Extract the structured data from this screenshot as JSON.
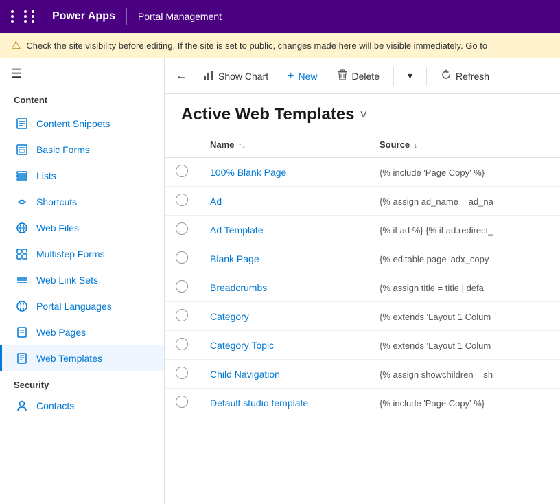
{
  "topbar": {
    "grid_label": "apps-grid",
    "title": "Power Apps",
    "subtitle": "Portal Management"
  },
  "warning": {
    "icon": "⚠",
    "text": "Check the site visibility before editing. If the site is set to public, changes made here will be visible immediately. Go to"
  },
  "sidebar": {
    "hamburger": "☰",
    "content_section": "Content",
    "items": [
      {
        "id": "content-snippets",
        "label": "Content Snippets",
        "icon": "📄"
      },
      {
        "id": "basic-forms",
        "label": "Basic Forms",
        "icon": "📋"
      },
      {
        "id": "lists",
        "label": "Lists",
        "icon": "📊"
      },
      {
        "id": "shortcuts",
        "label": "Shortcuts",
        "icon": "🔗"
      },
      {
        "id": "web-files",
        "label": "Web Files",
        "icon": "🌐"
      },
      {
        "id": "multistep-forms",
        "label": "Multistep Forms",
        "icon": "📑"
      },
      {
        "id": "web-link-sets",
        "label": "Web Link Sets",
        "icon": "🔗"
      },
      {
        "id": "portal-languages",
        "label": "Portal Languages",
        "icon": "🌍"
      },
      {
        "id": "web-pages",
        "label": "Web Pages",
        "icon": "📄"
      },
      {
        "id": "web-templates",
        "label": "Web Templates",
        "icon": "📄",
        "active": true
      }
    ],
    "security_section": "Security",
    "security_items": [
      {
        "id": "contacts",
        "label": "Contacts",
        "icon": "👤"
      }
    ]
  },
  "toolbar": {
    "back_label": "←",
    "show_chart_label": "Show Chart",
    "new_label": "New",
    "delete_label": "Delete",
    "more_label": "▾",
    "refresh_label": "Refresh"
  },
  "page": {
    "title": "Active Web Templates",
    "chevron": "˅"
  },
  "table": {
    "columns": [
      {
        "id": "select",
        "label": ""
      },
      {
        "id": "name",
        "label": "Name",
        "sort": "↑↓"
      },
      {
        "id": "source",
        "label": "Source",
        "sort": "↓"
      }
    ],
    "rows": [
      {
        "name": "100% Blank Page",
        "source": "{% include 'Page Copy' %}"
      },
      {
        "name": "Ad",
        "source": "{% assign ad_name = ad_na"
      },
      {
        "name": "Ad Template",
        "source": "{% if ad %} {% if ad.redirect_"
      },
      {
        "name": "Blank Page",
        "source": "{% editable page 'adx_copy"
      },
      {
        "name": "Breadcrumbs",
        "source": "{% assign title = title | defa"
      },
      {
        "name": "Category",
        "source": "{% extends 'Layout 1 Colum"
      },
      {
        "name": "Category Topic",
        "source": "{% extends 'Layout 1 Colum"
      },
      {
        "name": "Child Navigation",
        "source": "{% assign showchildren = sh"
      },
      {
        "name": "Default studio template",
        "source": "{% include 'Page Copy' %}"
      }
    ]
  }
}
